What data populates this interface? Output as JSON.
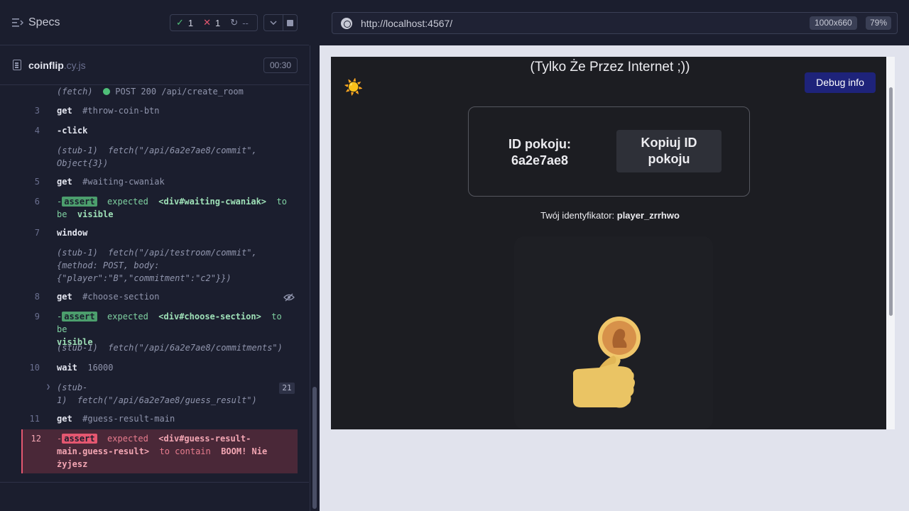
{
  "sidebar_header": {
    "title": "Specs",
    "passed": "1",
    "failed": "1",
    "pending": "--"
  },
  "spec_file": {
    "name": "coinflip",
    "ext": ".cy.js",
    "duration": "00:30"
  },
  "commands": {
    "c0_prefix": "(fetch)",
    "c0_text": "POST 200 /api/create_room",
    "c3_num": "3",
    "c3_cmd": "get",
    "c3_sel": "#throw-coin-btn",
    "c4_num": "4",
    "c4_cmd": "-click",
    "c4s_text": "(stub-1)  fetch(\"/api/6a2e7ae8/commit\",\nObject{3})",
    "c5_num": "5",
    "c5_cmd": "get",
    "c5_sel": "#waiting-cwaniak",
    "c6_num": "6",
    "c6_badge": "assert",
    "c6_a": "expected",
    "c6_b": "<div#waiting-cwaniak>",
    "c6_c": "to",
    "c6_d": "be",
    "c6_e": "visible",
    "c7_num": "7",
    "c7_cmd": "window",
    "c7s_text": "(stub-1)  fetch(\"/api/testroom/commit\",\n{method: POST, body:\n{\"player\":\"B\",\"commitment\":\"c2\"}})",
    "c8_num": "8",
    "c8_cmd": "get",
    "c8_sel": "#choose-section",
    "c9_num": "9",
    "c9_badge": "assert",
    "c9_a": "expected",
    "c9_b": "<div#choose-section>",
    "c9_c": "to be",
    "c9_e": "visible",
    "c9s_text": "(stub-1)  fetch(\"/api/6a2e7ae8/commitments\")",
    "c10_num": "10",
    "c10_cmd": "wait",
    "c10_sel": "16000",
    "c10s_text": "(stub-\n1)  fetch(\"/api/6a2e7ae8/guess_result\")",
    "c10s_count": "21",
    "c11_num": "11",
    "c11_cmd": "get",
    "c11_sel": "#guess-result-main",
    "c12_num": "12",
    "c12_badge": "assert",
    "c12_a": "expected",
    "c12_b": "<div#guess-result-\nmain.guess-result>",
    "c12_c": "to contain",
    "c12_d": "BOOM! Nie\nżyjesz"
  },
  "browser": {
    "url": "http://localhost:4567/",
    "viewport": "1000x660",
    "zoom": "79%"
  },
  "app": {
    "heading": "(Tylko Że Przez Internet ;))",
    "theme_icon": "☀️",
    "debug_label": "Debug info",
    "room_label": "ID pokoju:\n6a2e7ae8",
    "copy_label": "Kopiuj ID\npokoju",
    "player_prefix": "Twój identyfikator: ",
    "player_id": "player_zrrhwo"
  },
  "colors": {
    "pass": "#4fbf78",
    "fail": "#e45770",
    "debug_button": "#1e237a",
    "coin": "#e6a94a",
    "hand": "#e9c465"
  },
  "icons": [
    "specs-list-icon",
    "check-icon",
    "x-icon",
    "spinner-icon",
    "chevron-down-icon",
    "stop-icon",
    "file-icon",
    "globe-icon",
    "eye-slash-icon",
    "chevron-right-icon",
    "sun-icon",
    "coin-icon"
  ]
}
